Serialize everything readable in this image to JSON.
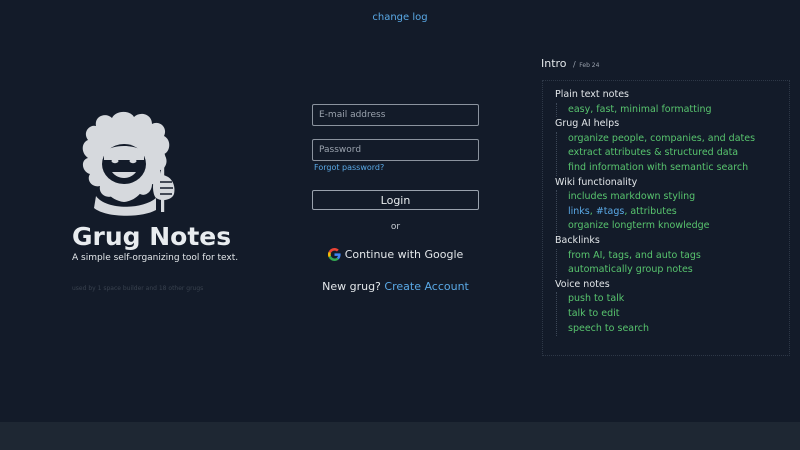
{
  "header": {
    "changelog_label": "change log"
  },
  "brand": {
    "title": "Grug Notes",
    "tagline": "A simple self-organizing tool for text.",
    "footnote": "used by 1 space builder and 18 other grugs"
  },
  "login": {
    "email_placeholder": "E-mail address",
    "password_placeholder": "Password",
    "forgot_label": "Forgot password?",
    "login_label": "Login",
    "or_label": "or",
    "google_label": "Continue with Google",
    "new_prompt": "New grug?",
    "create_label": "Create Account"
  },
  "intro": {
    "title": "Intro",
    "separator": "/",
    "date": "Feb 24",
    "sections": [
      {
        "title": "Plain text notes",
        "items": [
          "easy, fast, minimal formatting"
        ]
      },
      {
        "title": "Grug AI helps",
        "items": [
          "organize people, companies, and dates",
          "extract attributes & structured data",
          "find information with semantic search"
        ]
      },
      {
        "title": "Wiki functionality",
        "items": [
          "includes markdown styling",
          "__links__",
          "organize longterm knowledge"
        ]
      },
      {
        "title": "Backlinks",
        "items": [
          "from AI, tags, and auto tags",
          "automatically group notes"
        ]
      },
      {
        "title": "Voice notes",
        "items": [
          "push to talk",
          "talk to edit",
          "speech to search"
        ]
      }
    ],
    "links_line": {
      "links": "links",
      "sep1": ", ",
      "tags": "#tags",
      "sep2": ", ",
      "attributes": "attributes"
    }
  },
  "colors": {
    "background": "#131b29",
    "link": "#5aa9e6",
    "green": "#58c46e",
    "footer": "#1e2733"
  }
}
